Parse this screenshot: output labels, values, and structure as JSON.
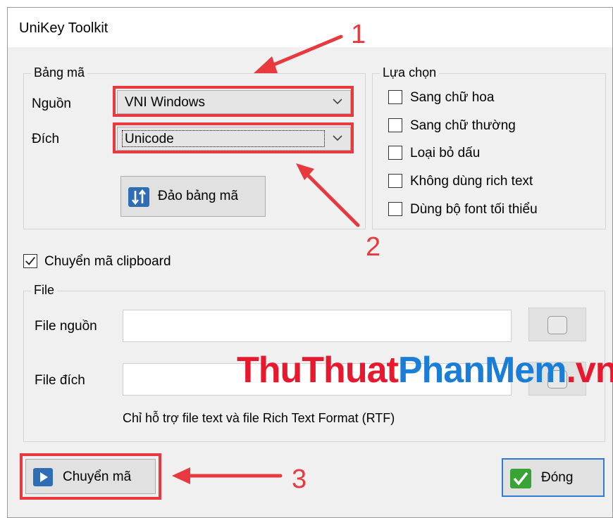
{
  "window": {
    "title": "UniKey Toolkit"
  },
  "bang_ma": {
    "group_label": "Bảng mã",
    "source_label": "Nguồn",
    "source_value": "VNI Windows",
    "target_label": "Đích",
    "target_value": "Unicode",
    "swap_button": "Đảo bảng mã"
  },
  "lua_chon": {
    "group_label": "Lựa chọn",
    "options": [
      {
        "label": "Sang chữ hoa",
        "checked": false
      },
      {
        "label": "Sang chữ thường",
        "checked": false
      },
      {
        "label": "Loại bỏ dấu",
        "checked": false
      },
      {
        "label": "Không dùng rich text",
        "checked": false
      },
      {
        "label": "Dùng bộ font tối thiểu",
        "checked": false
      }
    ]
  },
  "clipboard": {
    "label": "Chuyển mã clipboard",
    "checked": true
  },
  "file": {
    "group_label": "File",
    "source_label": "File nguồn",
    "target_label": "File đích",
    "source_value": "",
    "target_value": "",
    "note": "Chỉ hỗ trợ file text và file Rich Text Format (RTF)"
  },
  "buttons": {
    "convert": "Chuyển mã",
    "close": "Đóng"
  },
  "annotations": {
    "step1": "1",
    "step2": "2",
    "step3": "3"
  },
  "watermark": {
    "part1": "ThuThuat",
    "part2": "PhanMem",
    "part3": ".vn"
  },
  "colors": {
    "annotation_red": "#e8393f",
    "close_border": "#2d7ad8",
    "icon_blue": "#2f6db5",
    "check_green": "#3aa335"
  }
}
